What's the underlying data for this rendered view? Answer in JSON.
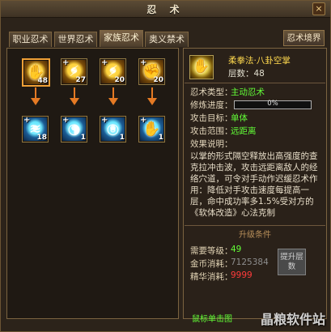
{
  "window": {
    "title": "忍 术",
    "close_label": "×"
  },
  "tabs": [
    {
      "label": "职业忍术"
    },
    {
      "label": "世界忍术"
    },
    {
      "label": "家族忍术"
    },
    {
      "label": "奥义禁术"
    }
  ],
  "realm_button": "忍术境界",
  "skills": {
    "top": [
      {
        "count": "48",
        "plus": "",
        "icon": "palm-icon",
        "selected": true
      },
      {
        "count": "27",
        "plus": "+",
        "icon": "claw-icon",
        "selected": false
      },
      {
        "count": "20",
        "plus": "+",
        "icon": "claw-icon",
        "selected": false
      },
      {
        "count": "20",
        "plus": "+",
        "icon": "fist-icon",
        "selected": false
      }
    ],
    "bottom": [
      {
        "count": "18",
        "plus": "+",
        "icon": "wind-icon"
      },
      {
        "count": "1",
        "plus": "+",
        "icon": "spiral-icon"
      },
      {
        "count": "1",
        "plus": "+",
        "icon": "target-icon"
      },
      {
        "count": "1",
        "plus": "+",
        "icon": "palm-blue-icon"
      }
    ]
  },
  "detail": {
    "name": "柔拳法·八卦空掌",
    "level_text": "层数：48",
    "type_label": "忍术类型：",
    "type_value": "主动忍术",
    "progress_label": "修炼进度：",
    "progress_value": "0%",
    "progress_fraction": 0,
    "target_label": "攻击目标：",
    "target_value": "单体",
    "range_label": "攻击范围：",
    "range_value": "远距离",
    "effect_label": "效果说明：",
    "description": "以掌的形式隔空释放出高强度的查克拉冲击波，攻击远距离敌人的经络穴道，可令对手动作迟缓忍术作用：降低对手攻击速度每提高一层，命中成功率多1.5%受对方的《软体改造》心法克制",
    "upgrade_title": "升级条件",
    "req_level_label": "需要等级：",
    "req_level_value": "49",
    "req_gold_label": "金币消耗：",
    "req_gold_value": "7125384",
    "req_essence_label": "精华消耗：",
    "req_essence_value": "9999",
    "levelup_button": "提升层数",
    "hint": "鼠标单击图",
    "watermark": "晶粮软件站"
  },
  "colors": {
    "gold": "#ffd94e",
    "green": "#62ff37",
    "red": "#ff3b3b",
    "gray": "#8d8d8d"
  }
}
